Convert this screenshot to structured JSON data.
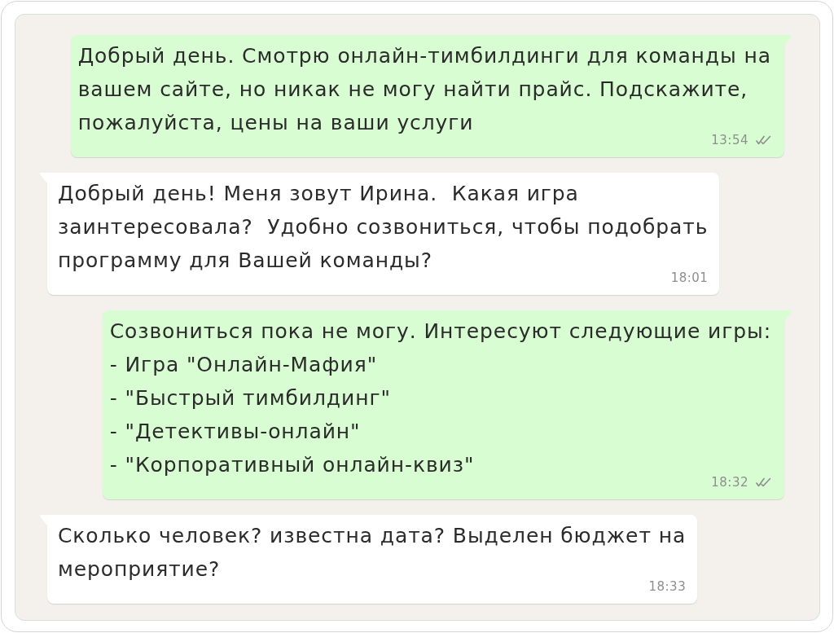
{
  "chat": {
    "messages": [
      {
        "kind": "outgoing",
        "text": "Добрый день. Смотрю онлайн-тимбилдинги для команды на\nвашем сайте, но никак не могу найти прайс. Подскажите,\nпожалуйста, цены на ваши услуги",
        "time": "13:54",
        "read": false
      },
      {
        "kind": "incoming",
        "text": "Добрый день! Меня зовут Ирина.  Какая игра\nзаинтересовала?  Удобно созвониться, чтобы подобрать\nпрограмму для Вашей команды?",
        "time": "18:01"
      },
      {
        "kind": "outgoing",
        "text": "Созвониться пока не могу. Интересуют следующие игры:\n- Игра \"Онлайн-Мафия\"\n- \"Быстрый тимбилдинг\"\n- \"Детективы-онлайн\"\n- \"Корпоративный онлайн-квиз\"",
        "time": "18:32",
        "read": false
      },
      {
        "kind": "incoming",
        "text": "Сколько человек? известна дата? Выделен бюджет на\nмероприятие?",
        "time": "18:33"
      }
    ]
  }
}
